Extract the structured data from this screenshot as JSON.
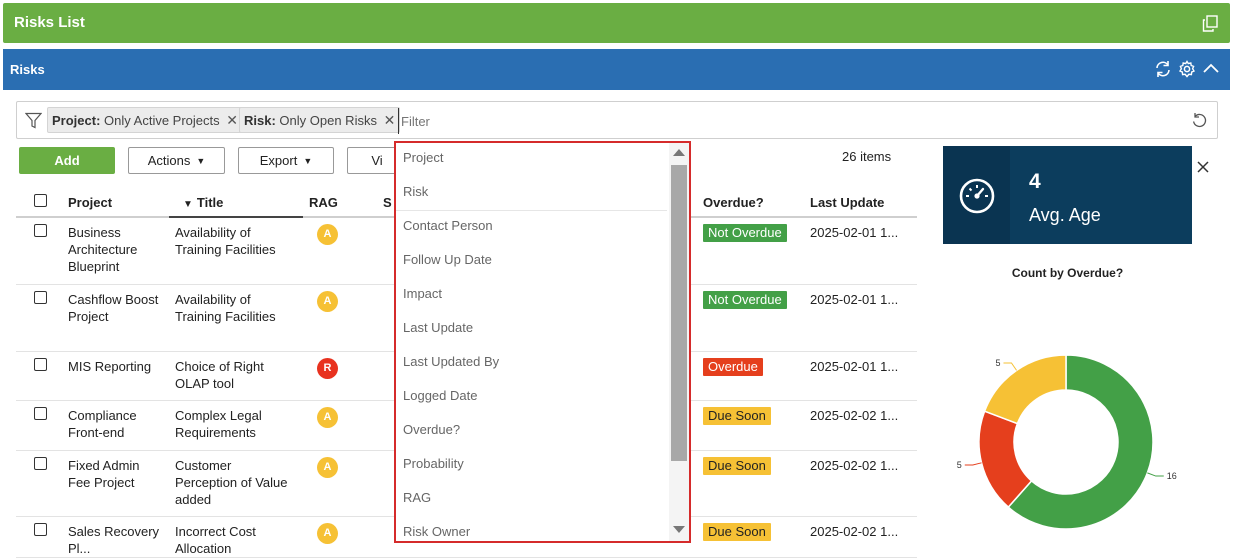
{
  "window": {
    "title": "Risks  List"
  },
  "panel": {
    "title": "Risks"
  },
  "filters": {
    "chips": [
      {
        "key": "Project:",
        "value": "Only Active Projects"
      },
      {
        "key": "Risk:",
        "value": "Only Open Risks"
      }
    ],
    "placeholder": "Filter"
  },
  "toolbar": {
    "add_label": "Add",
    "actions_label": "Actions",
    "export_label": "Export",
    "view_label": "Vi",
    "item_count": "26 items"
  },
  "table": {
    "columns": [
      "Project",
      "Title",
      "RAG",
      "S",
      "Overdue?",
      "Last Update"
    ],
    "rows": [
      {
        "project": "Business Architecture Blueprint",
        "title": "Availability of Training Facilities",
        "rag": "A",
        "overdue": "Not Overdue",
        "last_update": "2025-02-01 1..."
      },
      {
        "project": "Cashflow Boost Project",
        "title": "Availability of Training Facilities",
        "rag": "A",
        "overdue": "Not Overdue",
        "last_update": "2025-02-01 1..."
      },
      {
        "project": "MIS Reporting",
        "title": "Choice of Right OLAP tool",
        "rag": "R",
        "overdue": "Overdue",
        "last_update": "2025-02-01 1..."
      },
      {
        "project": "Compliance Front-end",
        "title": "Complex Legal Requirements",
        "rag": "A",
        "overdue": "Due Soon",
        "last_update": "2025-02-02 1..."
      },
      {
        "project": "Fixed Admin Fee Project",
        "title": "Customer Perception of Value added",
        "rag": "A",
        "overdue": "Due Soon",
        "last_update": "2025-02-02 1..."
      },
      {
        "project": "Sales Recovery Pl...",
        "title": "Incorrect Cost Allocation",
        "rag": "A",
        "overdue": "Due Soon",
        "last_update": "2025-02-02 1..."
      }
    ]
  },
  "dropdown": {
    "items": [
      "Project",
      "Risk",
      "Contact Person",
      "Follow Up Date",
      "Impact",
      "Last Update",
      "Last Updated By",
      "Logged Date",
      "Overdue?",
      "Probability",
      "RAG",
      "Risk Owner"
    ]
  },
  "kpi": {
    "value": "4",
    "label": "Avg. Age",
    "icon": "gauge-icon"
  },
  "colors": {
    "title_bar": "#6aae43",
    "panel_bar": "#2a6eb2",
    "kpi_bg": "#0c3d5d",
    "not_overdue": "#43a047",
    "overdue": "#e53f1d",
    "due_soon": "#f6c135"
  },
  "chart_data": {
    "type": "pie",
    "title": "Count by Overdue?",
    "series": [
      {
        "value": 16,
        "color": "#43a047"
      },
      {
        "value": 5,
        "color": "#e53f1d"
      },
      {
        "value": 5,
        "color": "#f6c135"
      }
    ],
    "legend": "none"
  }
}
